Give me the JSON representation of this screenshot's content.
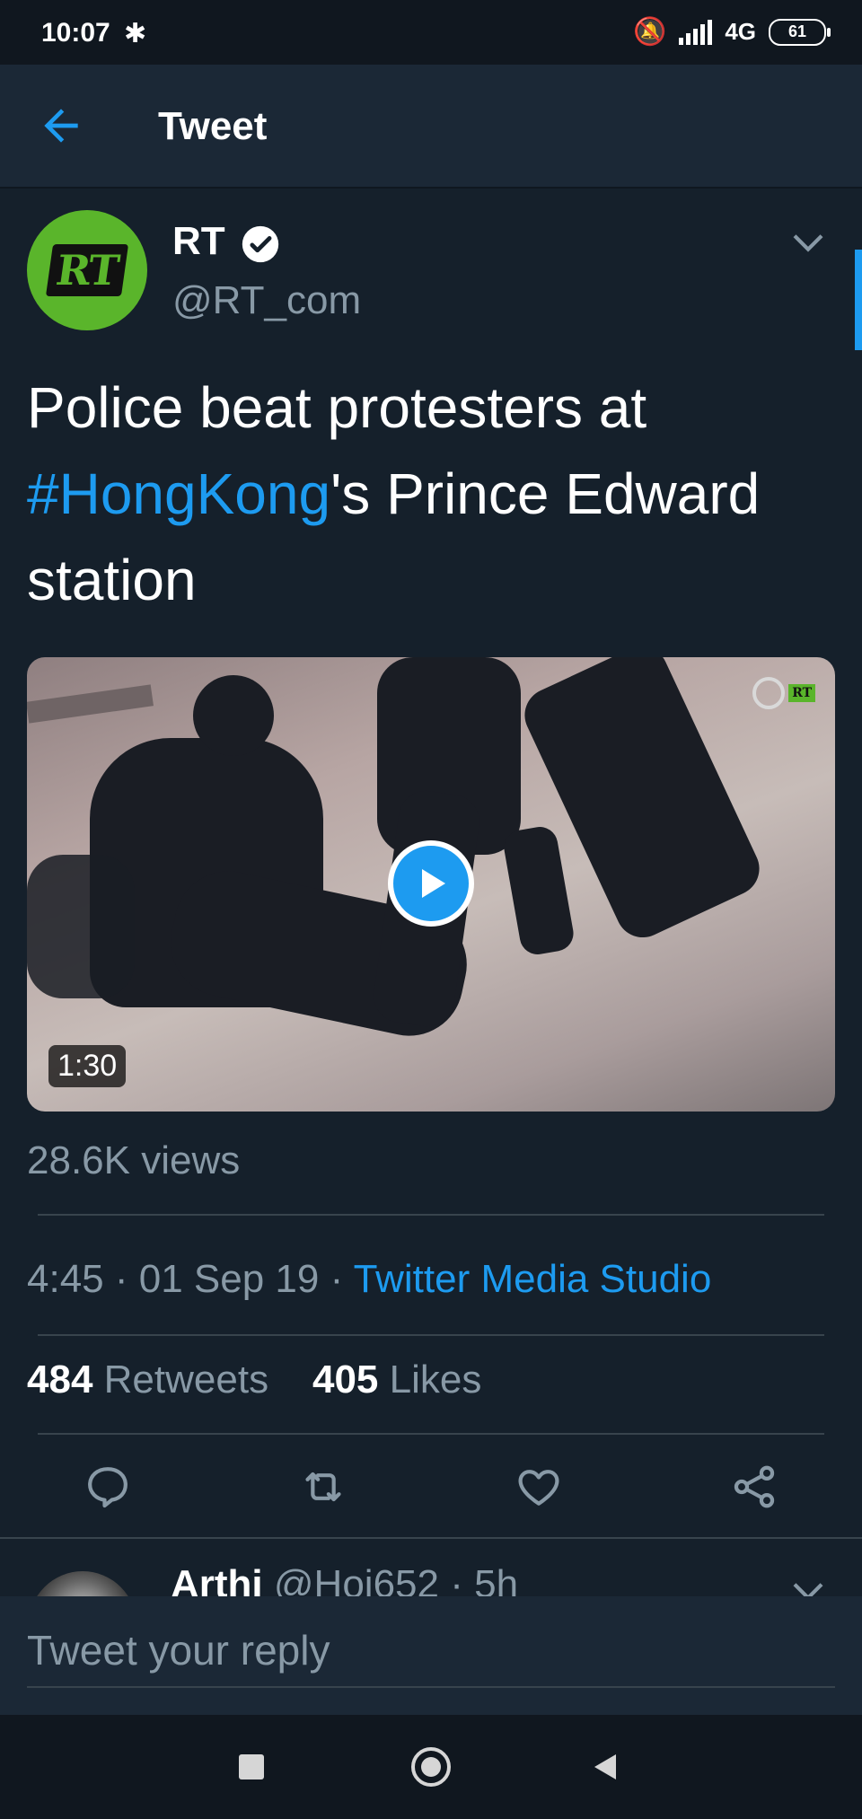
{
  "status_bar": {
    "time": "10:07",
    "network": "4G",
    "battery": "61",
    "icons": [
      "bluetooth-icon",
      "mute-icon",
      "signal-icon",
      "battery-icon"
    ]
  },
  "header": {
    "back_icon": "arrow-left-icon",
    "title": "Tweet"
  },
  "tweet": {
    "avatar_text": "RT",
    "display_name": "RT",
    "handle": "@RT_com",
    "text_before": "Police beat protesters at ",
    "hashtag": "#HongKong",
    "text_after": "'s Prince Edward station",
    "media": {
      "duration": "1:30",
      "watermark": "RT"
    },
    "views": "28.6K views",
    "timestamp": "4:45 · 01 Sep 19 · ",
    "source": "Twitter Media Studio",
    "retweets_count": "484",
    "retweets_label": "Retweets",
    "likes_count": "405",
    "likes_label": "Likes"
  },
  "reply_preview": {
    "name": "Arthi",
    "meta": "@Hoi652 · 5h"
  },
  "reply_bar": {
    "placeholder": "Tweet your reply"
  },
  "colors": {
    "background": "#15202b",
    "accent": "#1d9bf0",
    "secondary_text": "#8899a6",
    "rt_green": "#5ab52b"
  }
}
